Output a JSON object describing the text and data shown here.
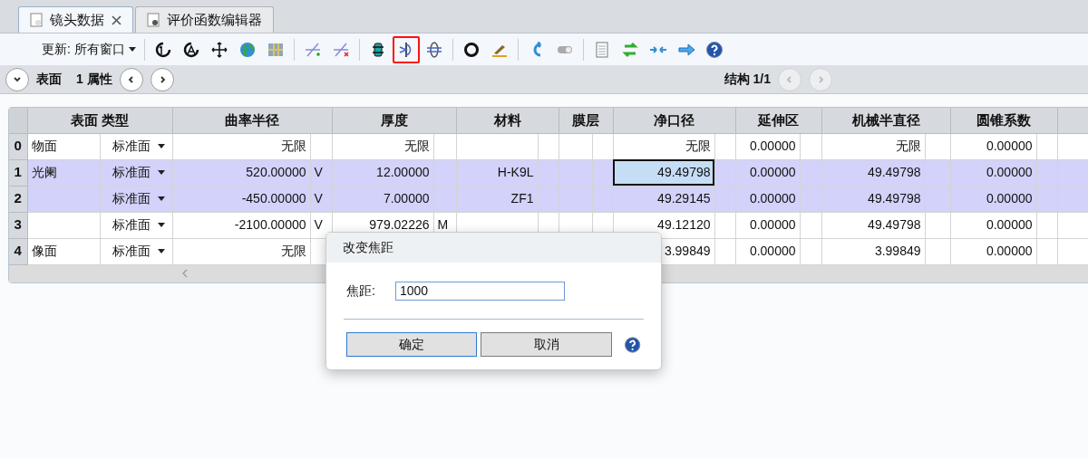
{
  "tabs": [
    {
      "label": "镜头数据",
      "selected": true,
      "closable": true
    },
    {
      "label": "评价函数编辑器",
      "selected": false,
      "closable": false
    }
  ],
  "toolbar": {
    "update_label": "更新: 所有窗口",
    "groups": [
      [
        {
          "kind": "refresh-one",
          "highlighted": false
        },
        {
          "kind": "refresh-a",
          "highlighted": false
        },
        {
          "kind": "crosshair",
          "highlighted": false
        },
        {
          "kind": "globe",
          "highlighted": false
        },
        {
          "kind": "map",
          "highlighted": false
        }
      ],
      [
        {
          "kind": "line-plus",
          "highlighted": false
        },
        {
          "kind": "line-x",
          "highlighted": false
        }
      ],
      [
        {
          "kind": "film",
          "highlighted": false
        },
        {
          "kind": "lens",
          "highlighted": true
        },
        {
          "kind": "lens-grid",
          "highlighted": false
        }
      ],
      [
        {
          "kind": "ring",
          "highlighted": false
        },
        {
          "kind": "brush",
          "highlighted": false
        }
      ],
      [
        {
          "kind": "undo",
          "highlighted": false
        },
        {
          "kind": "toggle",
          "highlighted": false
        }
      ],
      [
        {
          "kind": "document",
          "highlighted": false
        },
        {
          "kind": "swap",
          "highlighted": false
        },
        {
          "kind": "converge",
          "highlighted": false
        },
        {
          "kind": "arrow",
          "highlighted": false
        },
        {
          "kind": "help",
          "highlighted": false
        }
      ]
    ]
  },
  "nav": {
    "surface_label": "表面",
    "property_label": "1 属性",
    "config_label": "结构 1/1",
    "config_prev_disabled": true,
    "config_next_disabled": true
  },
  "table": {
    "columns": [
      "表面 类型",
      "曲率半径",
      "厚度",
      "材料",
      "膜层",
      "净口径",
      "延伸区",
      "机械半直径",
      "圆锥系数"
    ],
    "rows": [
      {
        "index": "0",
        "surface": "物面",
        "type": "标准面",
        "radius": "无限",
        "thickness": "无限",
        "material": "",
        "clear": "无限",
        "extension": "0.00000",
        "mech": "无限",
        "conic": "0.00000",
        "selected": false,
        "clear_focused": false
      },
      {
        "index": "1",
        "surface": "光阑",
        "type": "标准面",
        "radius": "520.00000",
        "radius_solve": "V",
        "thickness": "12.00000",
        "material": "H-K9L",
        "clear": "49.49798",
        "extension": "0.00000",
        "mech": "49.49798",
        "conic": "0.00000",
        "selected": true,
        "clear_focused": true
      },
      {
        "index": "2",
        "surface": "",
        "type": "标准面",
        "radius": "-450.00000",
        "radius_solve": "V",
        "thickness": "7.00000",
        "material": "ZF1",
        "clear": "49.29145",
        "extension": "0.00000",
        "mech": "49.49798",
        "conic": "0.00000",
        "selected": true,
        "clear_focused": false
      },
      {
        "index": "3",
        "surface": "",
        "type": "标准面",
        "radius": "-2100.00000",
        "radius_solve": "V",
        "thickness": "979.02226",
        "thickness_solve": "M",
        "material": "",
        "clear": "49.12120",
        "extension": "0.00000",
        "mech": "49.49798",
        "conic": "0.00000",
        "selected": false,
        "clear_focused": false
      },
      {
        "index": "4",
        "surface": "像面",
        "type": "标准面",
        "radius": "无限",
        "clear": "3.99849",
        "extension": "0.00000",
        "mech": "3.99849",
        "conic": "0.00000",
        "selected": false,
        "clear_focused": false
      }
    ]
  },
  "dialog": {
    "title": "改变焦距",
    "field_label": "焦距:",
    "value": "1000",
    "buttons": [
      "确定",
      "取消"
    ]
  }
}
